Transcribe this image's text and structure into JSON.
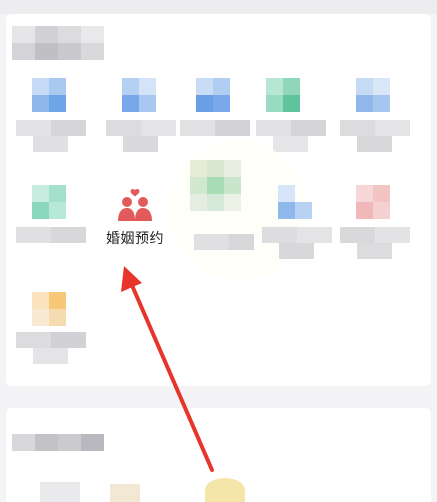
{
  "marriage_item": {
    "label": "婚姻预约",
    "icon": "couple-heart-icon",
    "icon_color": "#e25b5b"
  },
  "annotation": {
    "arrow_color": "#e8352b"
  }
}
